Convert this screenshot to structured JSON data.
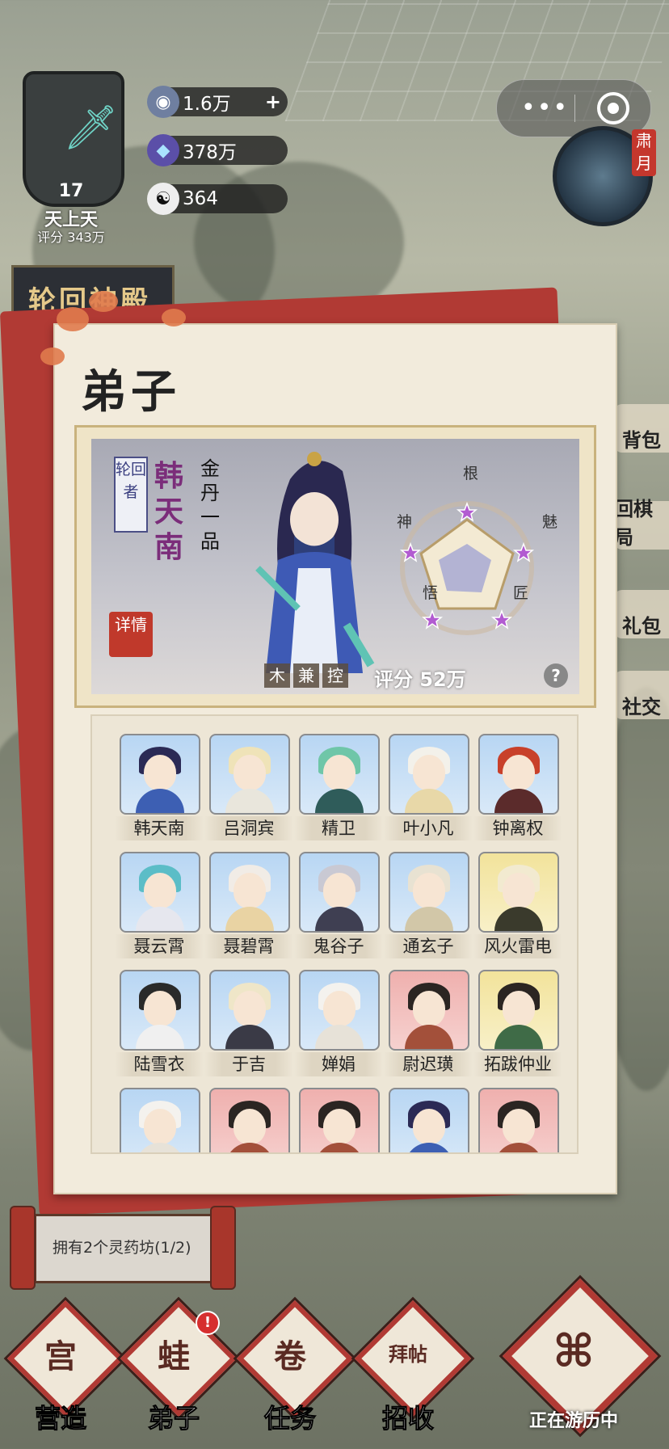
{
  "player": {
    "level": "17",
    "realm": "天上天",
    "score": "评分 343万"
  },
  "resources": [
    {
      "icon": "spirit-stone-icon",
      "value": "1.6万",
      "has_plus": true
    },
    {
      "icon": "crystal-icon",
      "value": "378万",
      "has_plus": false
    },
    {
      "icon": "yin-yang-icon",
      "value": "364",
      "has_plus": false
    }
  ],
  "month_tag": "肃月",
  "event_banner": "轮回神殿",
  "side_menu": [
    "背包",
    "回棋局",
    "礼包",
    "社交"
  ],
  "panel": {
    "title": "弟子",
    "hero": {
      "role": "轮回者",
      "name": "韩天南",
      "realm": "金丹一品",
      "detail_label": "详情",
      "tags": [
        "木",
        "兼",
        "控"
      ],
      "score": "评分 52万",
      "help": "?",
      "stats": [
        "根",
        "魅",
        "匠",
        "悟",
        "神"
      ]
    },
    "roster": [
      {
        "name": "韩天南",
        "bg": "blue",
        "hair": "#2b2a55",
        "body": "#3d5fb3"
      },
      {
        "name": "吕洞宾",
        "bg": "blue",
        "hair": "#efe3b8",
        "body": "#e9e6dc"
      },
      {
        "name": "精卫",
        "bg": "blue",
        "hair": "#6fc6a8",
        "body": "#2f5c5a"
      },
      {
        "name": "叶小凡",
        "bg": "blue",
        "hair": "#f3f1ea",
        "body": "#e8d8a8"
      },
      {
        "name": "钟离权",
        "bg": "blue",
        "hair": "#c8402a",
        "body": "#5b2b2b"
      },
      {
        "name": "聂云霄",
        "bg": "blue",
        "hair": "#5bbdc7",
        "body": "#e6e7ee"
      },
      {
        "name": "聂碧霄",
        "bg": "blue",
        "hair": "#f1ece6",
        "body": "#e9d3a3"
      },
      {
        "name": "鬼谷子",
        "bg": "blue",
        "hair": "#c9c9d3",
        "body": "#3f3f52"
      },
      {
        "name": "通玄子",
        "bg": "blue",
        "hair": "#e8e2d2",
        "body": "#d2c7a8"
      },
      {
        "name": "风火雷电",
        "bg": "gold",
        "hair": "#f2ead0",
        "body": "#3a3a2c"
      },
      {
        "name": "陆雪衣",
        "bg": "blue",
        "hair": "#2a2a2a",
        "body": "#f0f0f0"
      },
      {
        "name": "于吉",
        "bg": "blue",
        "hair": "#efe6c8",
        "body": "#3a3a46"
      },
      {
        "name": "婵娟",
        "bg": "blue",
        "hair": "#f4f2ee",
        "body": "#e7e2d8"
      },
      {
        "name": "尉迟璜",
        "bg": "pink",
        "hair": "#2b2522",
        "body": "#a3503a"
      },
      {
        "name": "拓跋仲业",
        "bg": "gold",
        "hair": "#2b2522",
        "body": "#3f6b47"
      },
      {
        "name": "",
        "bg": "blue",
        "hair": "#f4f2ee",
        "body": "#e7e2d8"
      },
      {
        "name": "",
        "bg": "pink",
        "hair": "#2b2522",
        "body": "#a3503a"
      },
      {
        "name": "",
        "bg": "pink",
        "hair": "#2b2522",
        "body": "#a3503a"
      },
      {
        "name": "",
        "bg": "blue",
        "hair": "#2b2a55",
        "body": "#3d5fb3"
      },
      {
        "name": "",
        "bg": "pink",
        "hair": "#2b2522",
        "body": "#a3503a"
      }
    ]
  },
  "tip": "拥有2个灵药坊(1/2)",
  "nav": [
    {
      "label": "营造",
      "glyph": "宫",
      "badge": false
    },
    {
      "label": "弟子",
      "glyph": "蛙",
      "badge": true
    },
    {
      "label": "任务",
      "glyph": "卷",
      "badge": false
    },
    {
      "label": "招收",
      "glyph": "拜帖",
      "badge": false
    }
  ],
  "travel_label": "正在游历中",
  "colors": {
    "accent_red": "#b13a34",
    "paper": "#f2ebdc",
    "name_purple": "#7b2d7a"
  }
}
